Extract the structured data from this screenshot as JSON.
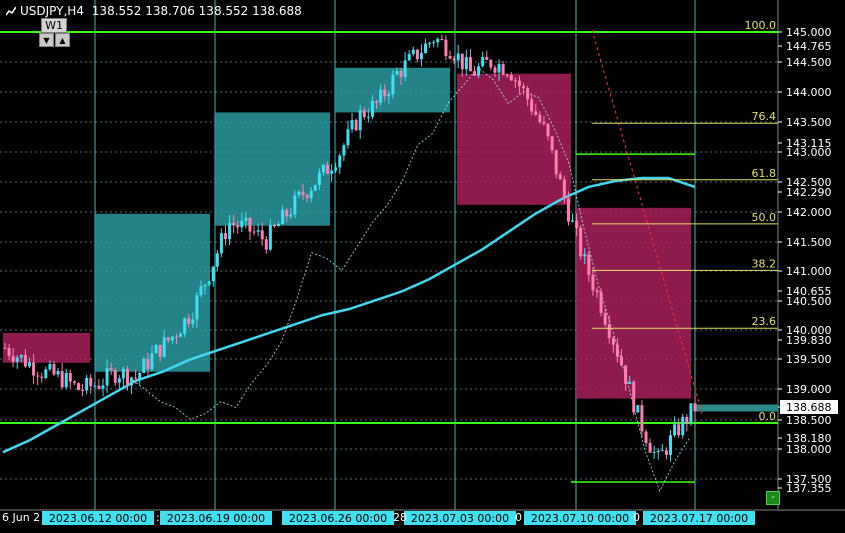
{
  "header": {
    "symbol": "USDJPY,H4",
    "ohlc": "138.552 138.706 138.552 138.688",
    "timeframe_label": "W1",
    "down_arrow": "▼",
    "up_arrow": "▲"
  },
  "colors": {
    "background": "#000000",
    "grid": "#556b78",
    "cyan_session": "#5ef0f0",
    "bull_box": "#2a9aa0",
    "bear_box": "#a8205c",
    "bull_candle": "#40e0f0",
    "bear_candle": "#ff80b0",
    "ma_line": "#40d8f0",
    "green_level": "#39ff14",
    "fib_line": "#e0e060",
    "current_price_bg": "#ffffff",
    "trend_red": "#ff3030"
  },
  "price_axis": {
    "labels": [
      "145.000",
      "144.765",
      "144.500",
      "144.000",
      "143.500",
      "143.115",
      "143.000",
      "142.500",
      "142.290",
      "142.000",
      "141.500",
      "141.000",
      "140.655",
      "140.500",
      "140.000",
      "139.830",
      "139.500",
      "139.000",
      "138.688",
      "138.500",
      "138.180",
      "138.000",
      "137.500",
      "137.355"
    ],
    "current_price": "138.688"
  },
  "fib_levels": [
    {
      "label": "100.0",
      "price": 145.0
    },
    {
      "label": "76.4",
      "price": 143.47
    },
    {
      "label": "61.8",
      "price": 142.52
    },
    {
      "label": "50.0",
      "price": 141.78
    },
    {
      "label": "38.2",
      "price": 141.0
    },
    {
      "label": "23.6",
      "price": 140.03
    },
    {
      "label": "0.0",
      "price": 138.44
    }
  ],
  "time_axis": {
    "partial_left": "6 Jun 2",
    "labels": [
      "2023.06.12 00:00",
      "2023.06.19 00:00",
      "2023.06.26 00:00",
      "2023.07.03 00:00",
      "2023.07.10 00:00",
      "2023.07.17 00:00"
    ],
    "separators": [
      ":",
      "28",
      "0",
      "0"
    ]
  },
  "corner_button": "-",
  "chart_data": {
    "type": "candlestick",
    "title": "USDJPY,H4",
    "ylim": [
      137.3,
      145.1
    ],
    "weekly_boxes": [
      {
        "start": "2023.06.05",
        "open": 139.95,
        "close": 139.45,
        "dir": "bear"
      },
      {
        "start": "2023.06.12",
        "open": 139.3,
        "close": 141.95,
        "dir": "bull"
      },
      {
        "start": "2023.06.19",
        "open": 141.75,
        "close": 143.65,
        "dir": "bull"
      },
      {
        "start": "2023.06.26",
        "open": 143.65,
        "close": 144.4,
        "dir": "bull"
      },
      {
        "start": "2023.07.03",
        "open": 144.3,
        "close": 142.1,
        "dir": "bear"
      },
      {
        "start": "2023.07.10",
        "open": 142.05,
        "close": 138.85,
        "dir": "bear"
      }
    ],
    "green_levels": [
      145.0,
      138.44,
      142.95,
      137.45
    ],
    "ma_series": [
      137.95,
      138.15,
      138.4,
      138.65,
      138.9,
      139.15,
      139.3,
      139.5,
      139.65,
      139.8,
      139.95,
      140.1,
      140.25,
      140.35,
      140.5,
      140.65,
      140.85,
      141.1,
      141.35,
      141.65,
      141.95,
      142.2,
      142.4,
      142.5,
      142.55,
      142.55,
      142.4
    ],
    "close_series": [
      139.7,
      139.5,
      139.3,
      139.2,
      139.0,
      139.1,
      139.3,
      139.2,
      139.6,
      139.9,
      140.3,
      141.0,
      141.8,
      141.7,
      141.5,
      141.9,
      142.3,
      142.6,
      143.0,
      143.6,
      143.8,
      144.3,
      144.6,
      144.9,
      144.7,
      144.3,
      144.5,
      144.4,
      143.9,
      143.3,
      142.2,
      141.2,
      140.4,
      139.5,
      138.5,
      137.8,
      138.3,
      138.7
    ]
  }
}
